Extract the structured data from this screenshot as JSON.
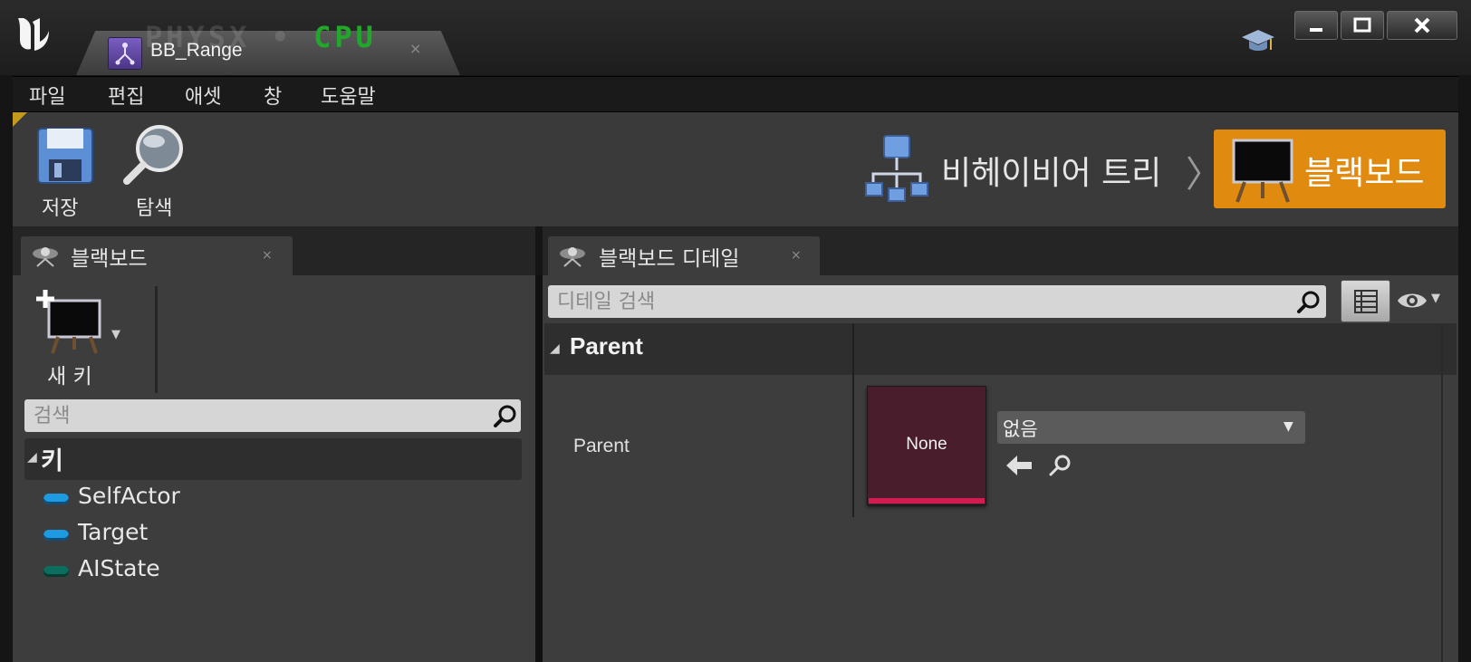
{
  "window": {
    "asset_tab_title": "BB_Range",
    "overlay_text": "PHYSX",
    "overlay_mode": "CPU",
    "tab_close_glyph": "×",
    "icons": [
      "unreal-logo-icon",
      "blackboard-asset-icon",
      "tutorial-hat-icon",
      "minimize-icon",
      "maximize-icon",
      "close-icon"
    ]
  },
  "menu": {
    "items": [
      "파일",
      "편집",
      "애셋",
      "창",
      "도움말"
    ]
  },
  "toolbar": {
    "save_label": "저장",
    "browse_label": "탐색",
    "mode_behavior_tree": "비헤이비어 트리",
    "mode_separator": "〉",
    "mode_blackboard": "블랙보드",
    "active_mode_color": "#e08a10"
  },
  "left_panel": {
    "tab_title": "블랙보드",
    "tab_close": "×",
    "new_key_label": "새 키",
    "search_placeholder": "검색",
    "category_label": "키",
    "keys": [
      {
        "name": "SelfActor",
        "color": "#1e9be0"
      },
      {
        "name": "Target",
        "color": "#1e9be0"
      },
      {
        "name": "AIState",
        "color": "#0a6e5e"
      }
    ]
  },
  "right_panel": {
    "tab_title": "블랙보드 디테일",
    "tab_close": "×",
    "search_placeholder": "디테일 검색",
    "category_label": "Parent",
    "property_label": "Parent",
    "asset_thumbnail_text": "None",
    "asset_thumbnail_color": "#4a1d2c",
    "asset_thumbnail_accent": "#d01c4e",
    "combo_value": "없음"
  }
}
